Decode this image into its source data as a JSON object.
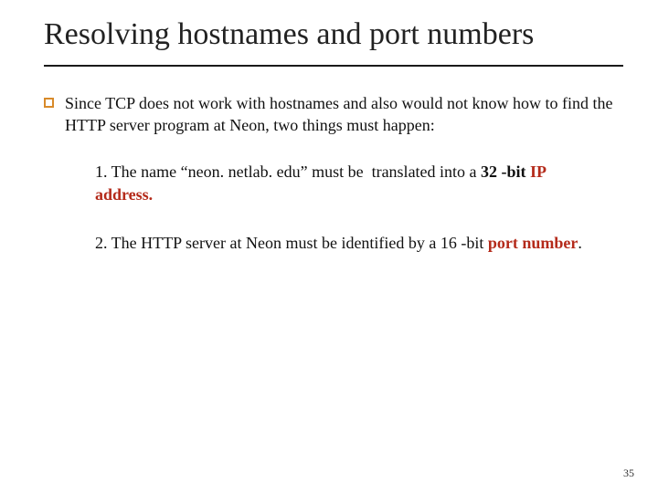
{
  "title": "Resolving hostnames and port numbers",
  "bullet": "Since TCP does not work with hostnames and also would not know how to find the HTTP server program at Neon, two things must happen:",
  "item1_prefix": "1. The name “neon. netlab. edu” must be  translated into a ",
  "item1_bold": "32 -bit ",
  "item1_red": "IP address.",
  "item2_prefix": "2. The HTTP server at Neon must be identified by a 16 -bit ",
  "item2_red": "port number",
  "item2_suffix": ".",
  "page_number": "35"
}
